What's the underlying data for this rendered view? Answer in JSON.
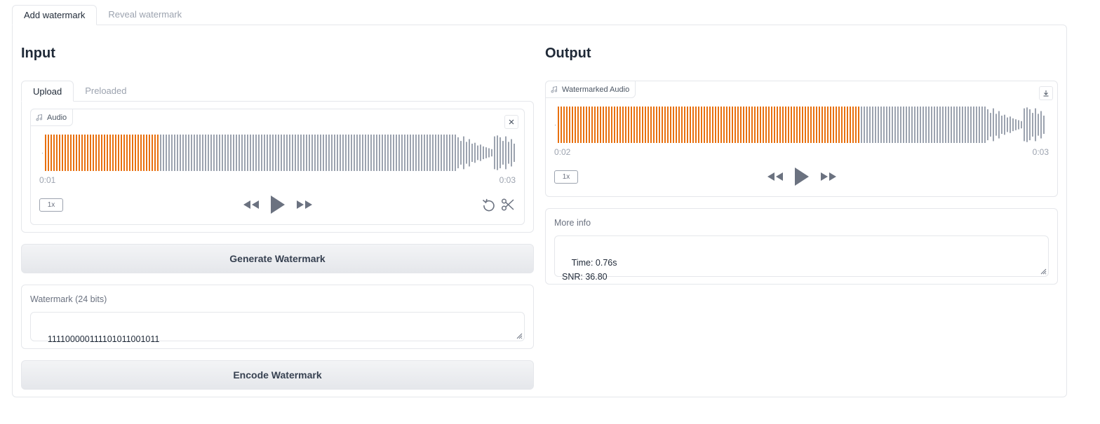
{
  "tabs": [
    "Add watermark",
    "Reveal watermark"
  ],
  "input": {
    "title": "Input",
    "subtabs": [
      "Upload",
      "Preloaded"
    ],
    "audio": {
      "label": "Audio",
      "current_time": "0:01",
      "duration": "0:03",
      "speed": "1x",
      "played_fraction": 0.24
    },
    "generate_button": "Generate Watermark",
    "watermark": {
      "label": "Watermark (24 bits)",
      "value": "111100000111101011001011"
    },
    "encode_button": "Encode Watermark"
  },
  "output": {
    "title": "Output",
    "audio": {
      "label": "Watermarked Audio",
      "current_time": "0:02",
      "duration": "0:03",
      "speed": "1x",
      "played_fraction": 0.62
    },
    "more_info": {
      "label": "More info",
      "value": "Time: 0.76s\nSNR: 36.80"
    }
  },
  "colors": {
    "played": "#e8700f",
    "unplayed": "#9ca3af",
    "border": "#e5e7eb"
  },
  "icons": [
    "music-note-icon",
    "close-icon",
    "rewind-icon",
    "play-icon",
    "fast-forward-icon",
    "undo-icon",
    "scissors-icon",
    "download-icon",
    "resize-handle-icon"
  ]
}
